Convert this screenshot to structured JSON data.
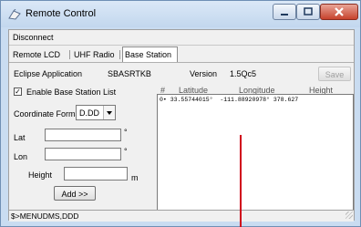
{
  "window": {
    "title": "Remote Control",
    "accent": "#c9dcf1",
    "close_color": "#c7422c"
  },
  "menu": {
    "disconnect": "Disconnect"
  },
  "tabs": [
    "Remote LCD",
    "UHF Radio",
    "Base Station"
  ],
  "app": {
    "label": "Eclipse Application",
    "name": "SBASRTKB",
    "version_label": "Version",
    "version": "1.5Qc5",
    "save": "Save"
  },
  "enable_list": {
    "label": "Enable Base Station List",
    "checked": true
  },
  "coord": {
    "label": "Coordinate Format",
    "value": "D.DD"
  },
  "fields": {
    "lat_label": "Lat",
    "lat_unit": "°",
    "lon_label": "Lon",
    "lon_unit": "°",
    "height_label": "Height",
    "height_unit": "m"
  },
  "add_button": "Add >>",
  "list": {
    "headers": [
      "#",
      "Latitude",
      "Longitude",
      "Height"
    ],
    "rows": [
      {
        "idx": "0",
        "marker": "•",
        "lat": "33.55744015°",
        "lon": "-111.88920978°",
        "height": "378.627"
      }
    ]
  },
  "status": "$>MENUDMS,DDD"
}
